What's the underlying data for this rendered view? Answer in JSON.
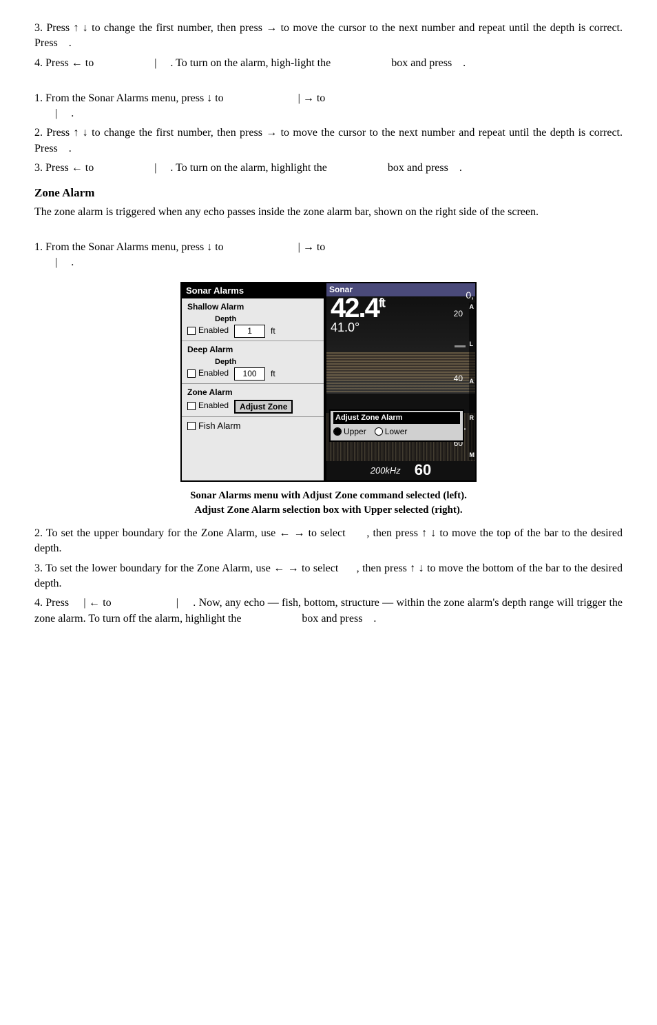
{
  "page": {
    "paragraphs": {
      "p1": "3. Press ↑ ↓ to change the first number, then press → to move the cursor to the next number and repeat until the depth is correct. Press     .",
      "p2_a": "4. Press ← to",
      "p2_b": "|     . To turn on the alarm, highlight the",
      "p2_c": "box and press     .",
      "p3": "1. From the Sonar Alarms menu, press ↓ to",
      "p3_b": "| → to",
      "p3_c": "|     .",
      "p4": "2. Press ↑ ↓ to change the first number, then press → to move the cursor to the next number and repeat until the depth is correct. Press     .",
      "p5_a": "3. Press ← to",
      "p5_b": "|     . To turn on the alarm, highlight",
      "p5_c": "the",
      "p5_d": "box and press     .",
      "zone_alarm_heading": "Zone Alarm",
      "zone_alarm_desc": "The zone alarm is triggered when any echo passes inside the zone alarm bar, shown on the right side of the screen.",
      "zone_p1_a": "1. From the Sonar Alarms menu, press ↓ to",
      "zone_p1_b": "| → to",
      "zone_p1_c": "|     .",
      "caption_line1": "Sonar Alarms menu with Adjust Zone command selected (left).",
      "caption_line2": "Adjust Zone Alarm selection box with Upper selected (right).",
      "zone_p2": "2. To set the upper boundary for the Zone Alarm, use ← → to select      , then press ↑ ↓ to move the top of the bar to the desired depth.",
      "zone_p3": "3. To set the lower boundary for the Zone Alarm, use ← → to select      , then press ↑ ↓ to move the bottom of the bar to the desired depth.",
      "zone_p4_a": "4. Press     | ← to",
      "zone_p4_b": "|     . Now, any echo — fish, bottom, structure — within the zone alarm's depth range will trigger the zone alarm. To turn off the alarm, highlight the",
      "zone_p4_c": "box and press     ."
    },
    "sonar_alarms_panel": {
      "title": "Sonar Alarms",
      "shallow_alarm": {
        "label": "Shallow Alarm",
        "enabled_label": "Enabled",
        "depth_label": "Depth",
        "depth_value": "1",
        "unit": "ft"
      },
      "deep_alarm": {
        "label": "Deep Alarm",
        "enabled_label": "Enabled",
        "depth_label": "Depth",
        "depth_value": "100",
        "unit": "ft"
      },
      "zone_alarm": {
        "label": "Zone Alarm",
        "enabled_label": "Enabled",
        "button_label": "Adjust Zone"
      },
      "fish_alarm": {
        "label": "Fish Alarm"
      }
    },
    "sonar_display": {
      "header": "Sonar",
      "big_number": "42.4",
      "unit": "ft",
      "sub_number": "41.0°",
      "top_right": "0,",
      "depth_markers": [
        "20",
        "40",
        "60"
      ],
      "alarm_label": "ALARM",
      "adjust_zone_title": "Adjust Zone Alarm",
      "upper_option": "Upper",
      "lower_option": "Lower",
      "frequency": "200kHz",
      "zoom": "60"
    }
  }
}
